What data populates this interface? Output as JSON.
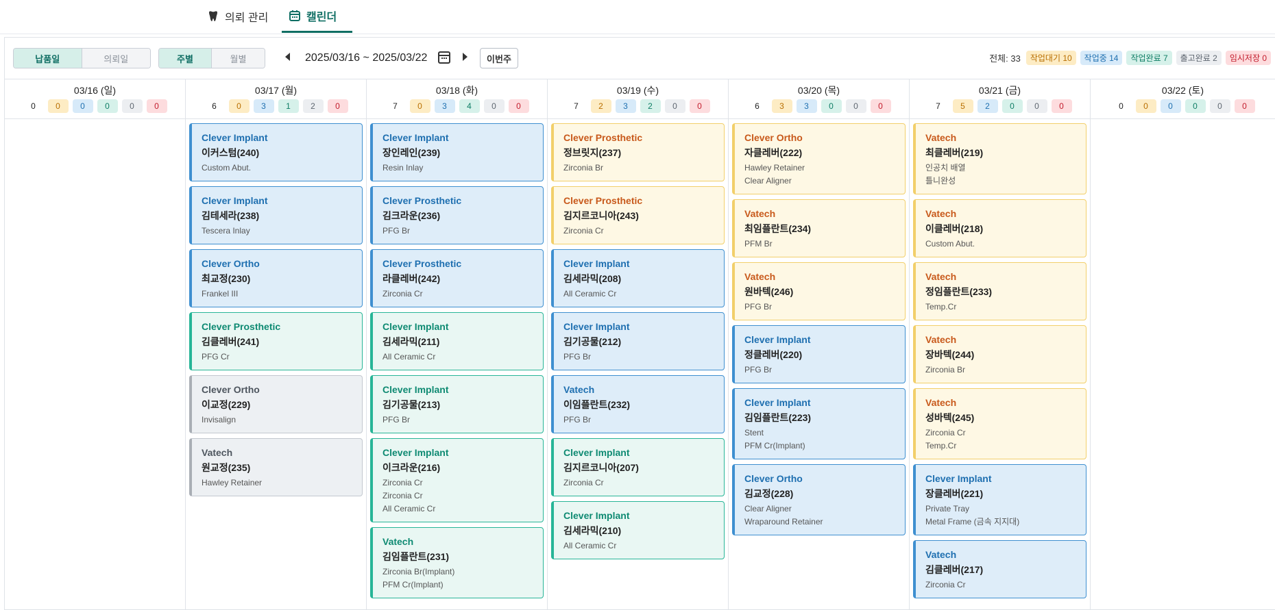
{
  "nav": {
    "tabs": [
      {
        "label": "의뢰 관리",
        "icon": "tooth-icon"
      },
      {
        "label": "캘린더",
        "icon": "calendar-icon"
      }
    ]
  },
  "toolbar": {
    "date_toggle": [
      "납품일",
      "의뢰일"
    ],
    "view_toggle": [
      "주별",
      "월별"
    ],
    "range": "2025/03/16 ~ 2025/03/22",
    "this_week": "이번주"
  },
  "summary": {
    "total": "전체: 33",
    "badges": [
      "작업대기 10",
      "작업중 14",
      "작업완료 7",
      "출고완료 2",
      "임시저장 0"
    ]
  },
  "status_colors": {
    "waiting": "#f2cf6a",
    "in_progress": "#3e8fd0",
    "completed": "#27b597",
    "shipped": "#c3c8cf",
    "temp_saved": "#c21b2b"
  },
  "days": [
    {
      "title": "03/16 (일)",
      "counts": [
        "0",
        "0",
        "0",
        "0",
        "0",
        "0"
      ],
      "cards": []
    },
    {
      "title": "03/17 (월)",
      "counts": [
        "6",
        "0",
        "3",
        "1",
        "2",
        "0"
      ],
      "cards": [
        {
          "status": "prog",
          "client": "Clever Implant",
          "patient": "이커스텀(240)",
          "items": [
            "Custom Abut."
          ]
        },
        {
          "status": "prog",
          "client": "Clever Implant",
          "patient": "김테세라(238)",
          "items": [
            "Tescera Inlay"
          ]
        },
        {
          "status": "prog",
          "client": "Clever Ortho",
          "patient": "최교정(230)",
          "items": [
            "Frankel III"
          ]
        },
        {
          "status": "done",
          "client": "Clever Prosthetic",
          "patient": "김클레버(241)",
          "items": [
            "PFG Cr"
          ]
        },
        {
          "status": "ship",
          "client": "Clever Ortho",
          "patient": "이교정(229)",
          "items": [
            "Invisalign"
          ]
        },
        {
          "status": "ship",
          "client": "Vatech",
          "patient": "원교정(235)",
          "items": [
            "Hawley Retainer"
          ]
        }
      ]
    },
    {
      "title": "03/18 (화)",
      "counts": [
        "7",
        "0",
        "3",
        "4",
        "0",
        "0"
      ],
      "cards": [
        {
          "status": "prog",
          "client": "Clever Implant",
          "patient": "장인레인(239)",
          "items": [
            "Resin Inlay"
          ]
        },
        {
          "status": "prog",
          "client": "Clever Prosthetic",
          "patient": "김크라운(236)",
          "items": [
            "PFG Br"
          ]
        },
        {
          "status": "prog",
          "client": "Clever Prosthetic",
          "patient": "라클레버(242)",
          "items": [
            "Zirconia Cr"
          ]
        },
        {
          "status": "done",
          "client": "Clever Implant",
          "patient": "김세라믹(211)",
          "items": [
            "All Ceramic Cr"
          ]
        },
        {
          "status": "done",
          "client": "Clever Implant",
          "patient": "김기공물(213)",
          "items": [
            "PFG Br"
          ]
        },
        {
          "status": "done",
          "client": "Clever Implant",
          "patient": "이크라운(216)",
          "items": [
            "Zirconia Cr",
            "Zirconia Cr",
            "All Ceramic Cr"
          ]
        },
        {
          "status": "done",
          "client": "Vatech",
          "patient": "김임플란트(231)",
          "items": [
            "Zirconia Br(Implant)",
            "PFM Cr(Implant)"
          ]
        }
      ]
    },
    {
      "title": "03/19 (수)",
      "counts": [
        "7",
        "2",
        "3",
        "2",
        "0",
        "0"
      ],
      "cards": [
        {
          "status": "wait",
          "client": "Clever Prosthetic",
          "patient": "정브릿지(237)",
          "items": [
            "Zirconia Br"
          ]
        },
        {
          "status": "wait",
          "client": "Clever Prosthetic",
          "patient": "김지르코니아(243)",
          "items": [
            "Zirconia Cr"
          ]
        },
        {
          "status": "prog",
          "client": "Clever Implant",
          "patient": "김세라믹(208)",
          "items": [
            "All Ceramic Cr"
          ]
        },
        {
          "status": "prog",
          "client": "Clever Implant",
          "patient": "김기공물(212)",
          "items": [
            "PFG Br"
          ]
        },
        {
          "status": "prog",
          "client": "Vatech",
          "patient": "이임플란트(232)",
          "items": [
            "PFG Br"
          ]
        },
        {
          "status": "done",
          "client": "Clever Implant",
          "patient": "김지르코니아(207)",
          "items": [
            "Zirconia Cr"
          ]
        },
        {
          "status": "done",
          "client": "Clever Implant",
          "patient": "김세라믹(210)",
          "items": [
            "All Ceramic Cr"
          ]
        }
      ]
    },
    {
      "title": "03/20 (목)",
      "counts": [
        "6",
        "3",
        "3",
        "0",
        "0",
        "0"
      ],
      "cards": [
        {
          "status": "wait",
          "client": "Clever Ortho",
          "patient": "자클레버(222)",
          "items": [
            "Hawley Retainer",
            "Clear Aligner"
          ]
        },
        {
          "status": "wait",
          "client": "Vatech",
          "patient": "최임플란트(234)",
          "items": [
            "PFM Br"
          ]
        },
        {
          "status": "wait",
          "client": "Vatech",
          "patient": "원바텍(246)",
          "items": [
            "PFG Br"
          ]
        },
        {
          "status": "prog",
          "client": "Clever Implant",
          "patient": "정클레버(220)",
          "items": [
            "PFG Br"
          ]
        },
        {
          "status": "prog",
          "client": "Clever Implant",
          "patient": "김임플란트(223)",
          "items": [
            "Stent",
            "PFM Cr(Implant)"
          ]
        },
        {
          "status": "prog",
          "client": "Clever Ortho",
          "patient": "김교정(228)",
          "items": [
            "Clear Aligner",
            "Wraparound Retainer"
          ]
        }
      ]
    },
    {
      "title": "03/21 (금)",
      "counts": [
        "7",
        "5",
        "2",
        "0",
        "0",
        "0"
      ],
      "cards": [
        {
          "status": "wait",
          "client": "Vatech",
          "patient": "최클레버(219)",
          "items": [
            "인공치 배열",
            "틀니완성"
          ]
        },
        {
          "status": "wait",
          "client": "Vatech",
          "patient": "이클레버(218)",
          "items": [
            "Custom Abut."
          ]
        },
        {
          "status": "wait",
          "client": "Vatech",
          "patient": "정임플란트(233)",
          "items": [
            "Temp.Cr"
          ]
        },
        {
          "status": "wait",
          "client": "Vatech",
          "patient": "장바텍(244)",
          "items": [
            "Zirconia Br"
          ]
        },
        {
          "status": "wait",
          "client": "Vatech",
          "patient": "성바텍(245)",
          "items": [
            "Zirconia Cr",
            "Temp.Cr"
          ]
        },
        {
          "status": "prog",
          "client": "Clever Implant",
          "patient": "장클레버(221)",
          "items": [
            "Private Tray",
            "Metal Frame (금속 지지대)"
          ]
        },
        {
          "status": "prog",
          "client": "Vatech",
          "patient": "김클레버(217)",
          "items": [
            "Zirconia Cr"
          ]
        }
      ]
    },
    {
      "title": "03/22 (토)",
      "counts": [
        "0",
        "0",
        "0",
        "0",
        "0",
        "0"
      ],
      "cards": []
    }
  ]
}
